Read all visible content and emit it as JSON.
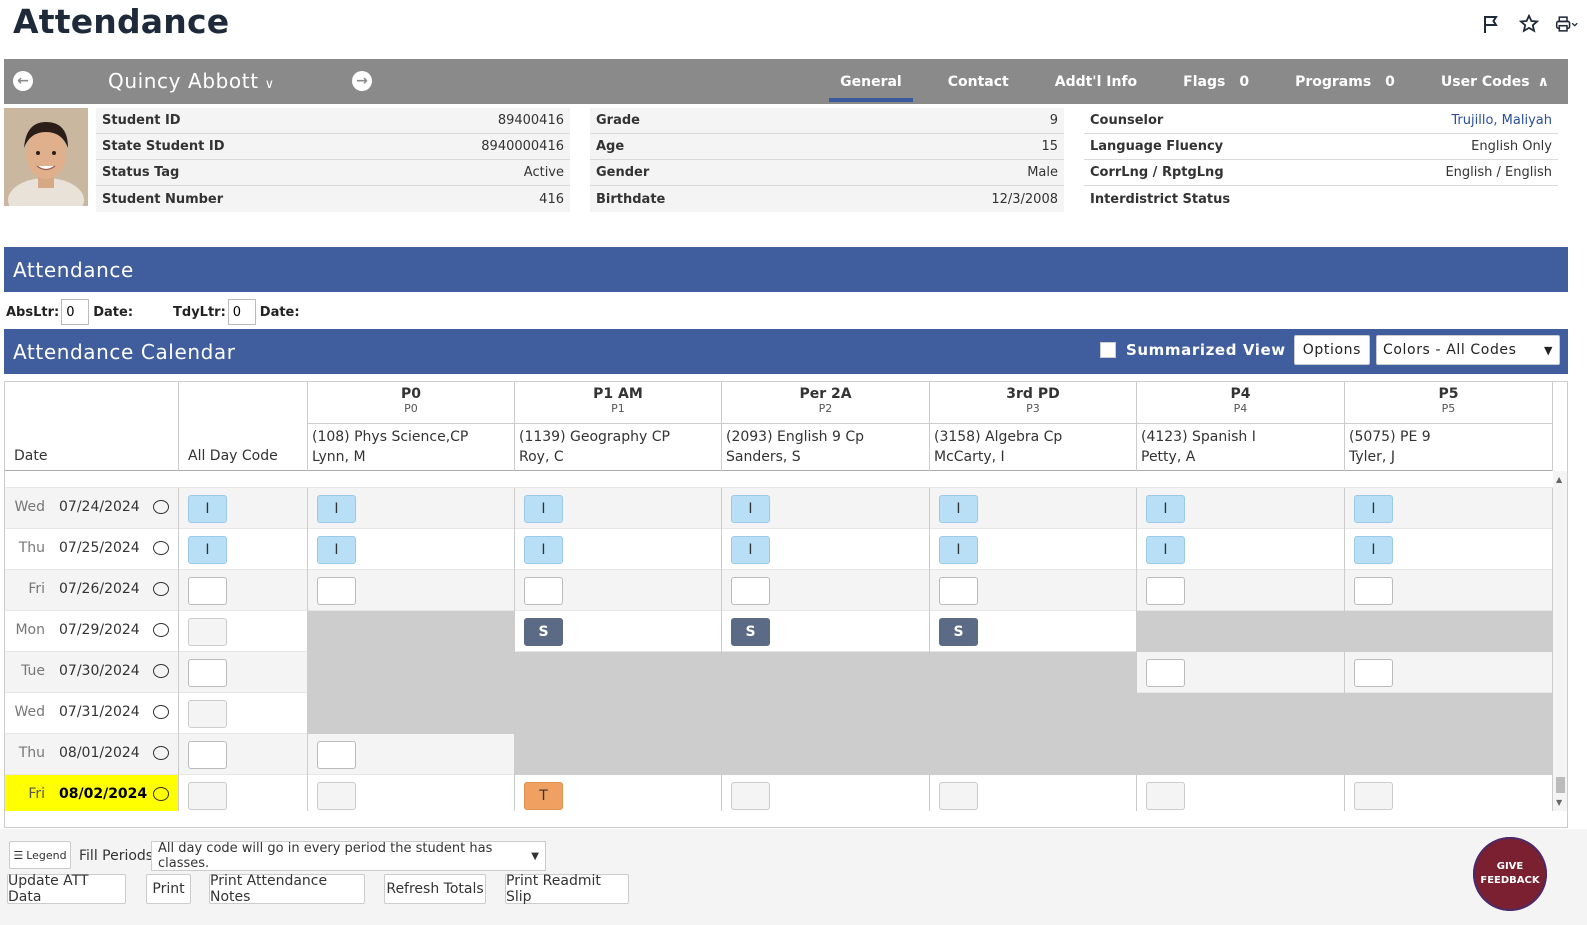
{
  "page": {
    "title": "Attendance"
  },
  "student": {
    "name": "Quincy Abbott",
    "tabs": [
      {
        "label": "General",
        "count": ""
      },
      {
        "label": "Contact",
        "count": ""
      },
      {
        "label": "Addt'l Info",
        "count": ""
      },
      {
        "label": "Flags",
        "count": "0"
      },
      {
        "label": "Programs",
        "count": "0"
      },
      {
        "label": "User Codes",
        "count": ""
      }
    ],
    "info_left": [
      {
        "label": "Student ID",
        "value": "89400416"
      },
      {
        "label": "State Student ID",
        "value": "8940000416"
      },
      {
        "label": "Status Tag",
        "value": "Active"
      },
      {
        "label": "Student Number",
        "value": "416"
      }
    ],
    "info_mid": [
      {
        "label": "Grade",
        "value": "9"
      },
      {
        "label": "Age",
        "value": "15"
      },
      {
        "label": "Gender",
        "value": "Male"
      },
      {
        "label": "Birthdate",
        "value": "12/3/2008"
      }
    ],
    "info_right": [
      {
        "label": "Counselor",
        "value": "Trujillo, Maliyah"
      },
      {
        "label": "Language Fluency",
        "value": "English Only"
      },
      {
        "label": "CorrLng / RptgLng",
        "value": "English / English"
      },
      {
        "label": "Interdistrict Status",
        "value": ""
      }
    ]
  },
  "attendance": {
    "header": "Attendance",
    "abs_label": "AbsLtr:",
    "abs_value": "0",
    "date_label_1": "Date:",
    "tdy_label": "TdyLtr:",
    "tdy_value": "0",
    "date_label_2": "Date:"
  },
  "calendar": {
    "header": "Attendance Calendar",
    "summarized_label": "Summarized View",
    "options_label": "Options",
    "colors_value": "Colors - All Codes",
    "col_date": "Date",
    "col_all_day": "All Day Code",
    "periods": [
      {
        "name": "P0",
        "sub": "P0",
        "course": "(108) Phys Science,CP",
        "teacher": "Lynn, M"
      },
      {
        "name": "P1 AM",
        "sub": "P1",
        "course": "(1139) Geography CP",
        "teacher": "Roy, C"
      },
      {
        "name": "Per 2A",
        "sub": "P2",
        "course": "(2093) English 9 Cp",
        "teacher": "Sanders, S"
      },
      {
        "name": "3rd PD",
        "sub": "P3",
        "course": "(3158) Algebra Cp",
        "teacher": "McCarty, I"
      },
      {
        "name": "P4",
        "sub": "P4",
        "course": "(4123) Spanish I",
        "teacher": "Petty, A"
      },
      {
        "name": "P5",
        "sub": "P5",
        "course": "(5075) PE 9",
        "teacher": "Tyler, J"
      }
    ],
    "rows": [
      {
        "dow": "Wed",
        "date": "07/24/2024",
        "all": "I",
        "cells": [
          "I",
          "I",
          "I",
          "I",
          "I",
          "I"
        ]
      },
      {
        "dow": "Thu",
        "date": "07/25/2024",
        "all": "I",
        "cells": [
          "I",
          "I",
          "I",
          "I",
          "I",
          "I"
        ]
      },
      {
        "dow": "Fri",
        "date": "07/26/2024",
        "all": "",
        "cells": [
          "",
          "",
          "",
          "",
          "",
          ""
        ]
      },
      {
        "dow": "Mon",
        "date": "07/29/2024",
        "all": "",
        "cells": [
          "",
          "S",
          "S",
          "S",
          "",
          ""
        ]
      },
      {
        "dow": "Tue",
        "date": "07/30/2024",
        "all": "",
        "cells": [
          "",
          "",
          "",
          "",
          "",
          ""
        ]
      },
      {
        "dow": "Wed",
        "date": "07/31/2024",
        "all": "",
        "cells": [
          "",
          "",
          "",
          "",
          "",
          ""
        ]
      },
      {
        "dow": "Thu",
        "date": "08/01/2024",
        "all": "",
        "cells": [
          "",
          "",
          "",
          "",
          "",
          ""
        ]
      },
      {
        "dow": "Fri",
        "date": "08/02/2024",
        "all": "",
        "cells": [
          "",
          "T",
          "",
          "",
          "",
          ""
        ]
      }
    ]
  },
  "footer": {
    "legend_label": "Legend",
    "fill_periods_label": "Fill Periods:",
    "fill_periods_value": "All day code will go in every period the student has classes.",
    "buttons": [
      "Update ATT Data",
      "Print",
      "Print Attendance Notes",
      "Refresh Totals",
      "Print Readmit Slip"
    ],
    "feedback_label": "GIVE FEEDBACK"
  },
  "colors": {
    "header_blue": "#405d9d",
    "bar_grey": "#8a8a8a",
    "code_I": "#b8dff5",
    "code_S": "#5b6a85",
    "code_T": "#f0a060",
    "today": "#ffff00"
  }
}
